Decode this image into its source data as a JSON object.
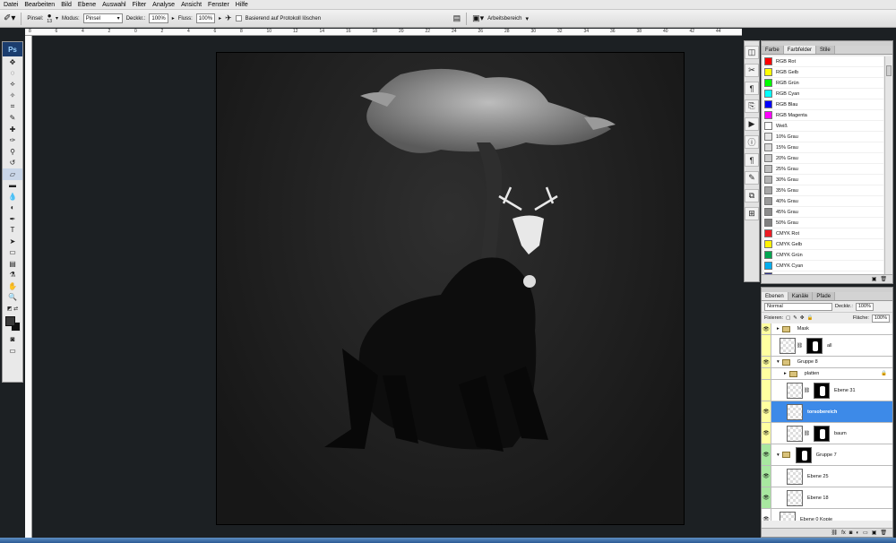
{
  "menu": [
    "Datei",
    "Bearbeiten",
    "Bild",
    "Ebene",
    "Auswahl",
    "Filter",
    "Analyse",
    "Ansicht",
    "Fenster",
    "Hilfe"
  ],
  "options": {
    "brush_label": "Pinsel:",
    "brush_size": "13",
    "mode_label": "Modus:",
    "mode_value": "Pinsel",
    "opacity_label": "Deckkr.:",
    "opacity_value": "100%",
    "flow_label": "Fluss:",
    "flow_value": "100%",
    "erase_history_label": "Basierend auf Protokoll löschen",
    "workspace_label": "Arbeitsbereich"
  },
  "ruler_ticks": [
    "8",
    "6",
    "4",
    "2",
    "0",
    "2",
    "4",
    "6",
    "8",
    "10",
    "12",
    "14",
    "16",
    "18",
    "20",
    "22",
    "24",
    "26",
    "28",
    "30",
    "32",
    "34",
    "36",
    "38",
    "40",
    "42",
    "44"
  ],
  "swatches_panel": {
    "tabs": [
      "Farbe",
      "Farbfelder",
      "Stile"
    ],
    "active_tab": 1,
    "items": [
      {
        "name": "RGB Rot",
        "color": "#ff0000"
      },
      {
        "name": "RGB Gelb",
        "color": "#ffff00"
      },
      {
        "name": "RGB Grün",
        "color": "#00ff00"
      },
      {
        "name": "RGB Cyan",
        "color": "#00ffff"
      },
      {
        "name": "RGB Blau",
        "color": "#0000ff"
      },
      {
        "name": "RGB Magenta",
        "color": "#ff00ff"
      },
      {
        "name": "Weiß",
        "color": "#ffffff"
      },
      {
        "name": "10% Grau",
        "color": "#e6e6e6"
      },
      {
        "name": "15% Grau",
        "color": "#d9d9d9"
      },
      {
        "name": "20% Grau",
        "color": "#cccccc"
      },
      {
        "name": "25% Grau",
        "color": "#bfbfbf"
      },
      {
        "name": "30% Grau",
        "color": "#b3b3b3"
      },
      {
        "name": "35% Grau",
        "color": "#a6a6a6"
      },
      {
        "name": "40% Grau",
        "color": "#999999"
      },
      {
        "name": "45% Grau",
        "color": "#8c8c8c"
      },
      {
        "name": "50% Grau",
        "color": "#808080"
      },
      {
        "name": "CMYK Rot",
        "color": "#ed1c24"
      },
      {
        "name": "CMYK Gelb",
        "color": "#fff200"
      },
      {
        "name": "CMYK Grün",
        "color": "#00a651"
      },
      {
        "name": "CMYK Cyan",
        "color": "#00aeef"
      },
      {
        "name": "CMYK Blau",
        "color": "#2e3192"
      }
    ]
  },
  "layers_panel": {
    "tabs": [
      "Ebenen",
      "Kanäle",
      "Pfade"
    ],
    "active_tab": 0,
    "blend_mode": "Normal",
    "opacity_label": "Deckkr.:",
    "opacity_value": "100%",
    "lock_label": "Fixieren:",
    "fill_label": "Fläche:",
    "fill_value": "100%",
    "layers": [
      {
        "name": "Mask",
        "kind": "group",
        "indent": 0,
        "visible": true,
        "selected": false,
        "tag": "#ffffa0",
        "expanded": false
      },
      {
        "name": "all",
        "kind": "layer-mask",
        "indent": 0,
        "visible": false,
        "selected": false,
        "tag": "#ffffa0"
      },
      {
        "name": "Gruppe 8",
        "kind": "group",
        "indent": 0,
        "visible": true,
        "selected": false,
        "tag": "#ffffa0",
        "expanded": true
      },
      {
        "name": "platten",
        "kind": "group",
        "indent": 1,
        "visible": false,
        "selected": false,
        "tag": "#ffffa0",
        "expanded": false,
        "locked": true
      },
      {
        "name": "Ebene 31",
        "kind": "layer-mask",
        "indent": 1,
        "visible": false,
        "selected": false,
        "tag": "#ffffa0"
      },
      {
        "name": "torsobereich",
        "kind": "layer",
        "indent": 1,
        "visible": true,
        "selected": true,
        "tag": "#ffffa0"
      },
      {
        "name": "baum",
        "kind": "layer-mask",
        "indent": 1,
        "visible": true,
        "selected": false,
        "tag": "#ffffa0"
      },
      {
        "name": "Gruppe 7",
        "kind": "group-mask",
        "indent": 0,
        "visible": true,
        "selected": false,
        "tag": "#a8e8a0",
        "expanded": true
      },
      {
        "name": "Ebene 25",
        "kind": "layer",
        "indent": 1,
        "visible": true,
        "selected": false,
        "tag": "#a8e8a0"
      },
      {
        "name": "Ebene 18",
        "kind": "layer",
        "indent": 1,
        "visible": true,
        "selected": false,
        "tag": "#a8e8a0"
      },
      {
        "name": "Ebene 0 Kopie",
        "kind": "layer",
        "indent": 0,
        "visible": true,
        "selected": false,
        "tag": "#ffffff"
      }
    ]
  },
  "colors": {
    "accent": "#3d8ae8",
    "canvas_bg": "#1c2023"
  }
}
